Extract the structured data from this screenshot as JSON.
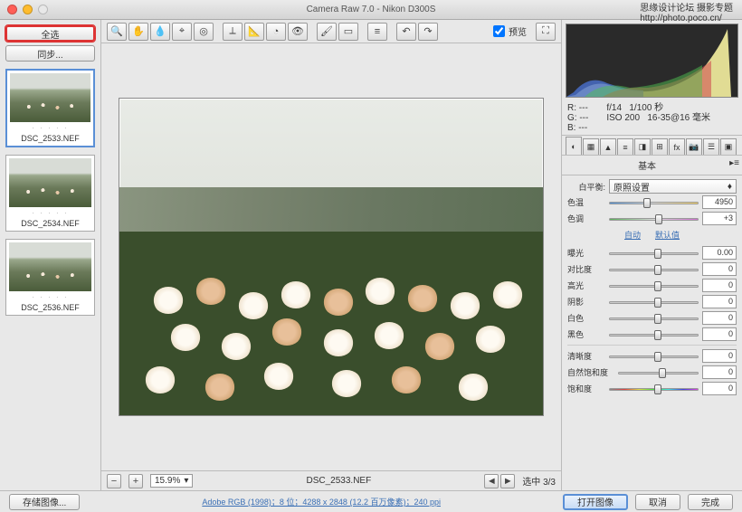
{
  "window": {
    "title": "Camera Raw 7.0 - Nikon D300S"
  },
  "watermark": {
    "line1": "思缘设计论坛 摄影专题",
    "line2": "http://photo.poco.cn/"
  },
  "filmstrip": {
    "select_all": "全选",
    "sync": "同步...",
    "thumbs": [
      {
        "name": "DSC_2533.NEF"
      },
      {
        "name": "DSC_2534.NEF"
      },
      {
        "name": "DSC_2536.NEF"
      }
    ]
  },
  "toolbar": {
    "preview_label": "预览"
  },
  "statusbar": {
    "zoom": "15.9%",
    "filename": "DSC_2533.NEF",
    "selection": "选中 3/3"
  },
  "panel": {
    "rgb": {
      "r": "R: ---",
      "g": "G: ---",
      "b": "B: ---"
    },
    "exif": {
      "aperture": "f/14",
      "shutter": "1/100 秒",
      "iso": "ISO 200",
      "lens": "16-35@16 毫米"
    },
    "title": "基本",
    "wb_label": "白平衡:",
    "wb_value": "原照设置",
    "auto": "自动",
    "default": "默认值",
    "sliders": {
      "temp": {
        "label": "色温",
        "value": "4950",
        "pos": 38
      },
      "tint": {
        "label": "色调",
        "value": "+3",
        "pos": 52
      },
      "exposure": {
        "label": "曝光",
        "value": "0.00",
        "pos": 50
      },
      "contrast": {
        "label": "对比度",
        "value": "0",
        "pos": 50
      },
      "highlights": {
        "label": "高光",
        "value": "0",
        "pos": 50
      },
      "shadows": {
        "label": "阴影",
        "value": "0",
        "pos": 50
      },
      "whites": {
        "label": "白色",
        "value": "0",
        "pos": 50
      },
      "blacks": {
        "label": "黑色",
        "value": "0",
        "pos": 50
      },
      "clarity": {
        "label": "清晰度",
        "value": "0",
        "pos": 50
      },
      "vibrance": {
        "label": "自然饱和度",
        "value": "0",
        "pos": 50
      },
      "saturation": {
        "label": "饱和度",
        "value": "0",
        "pos": 50
      }
    }
  },
  "footer": {
    "save": "存储图像...",
    "info": "Adobe RGB (1998)；8 位；4288 x 2848 (12.2 百万像素)；240 ppi",
    "open": "打开图像",
    "cancel": "取消",
    "done": "完成"
  }
}
